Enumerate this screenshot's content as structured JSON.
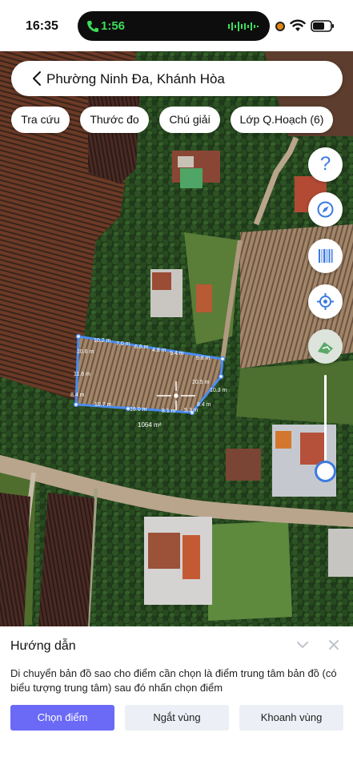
{
  "status_bar": {
    "time": "16:35",
    "call_timer": "1:56",
    "icons": [
      "phone-icon",
      "waveform-icon",
      "recording-dot-icon",
      "wifi-icon",
      "battery-icon"
    ]
  },
  "search": {
    "location": "Phường Ninh Đa, Khánh Hòa",
    "back_icon": "chevron-left-icon"
  },
  "chips": [
    "Tra cứu",
    "Thước đo",
    "Chú giải",
    "Lớp Q.Hoạch (6)"
  ],
  "side_controls": [
    "help-icon",
    "compass-icon",
    "barcode-icon",
    "locate-icon",
    "layers-icon"
  ],
  "map": {
    "parcel_area": "1064 m²",
    "measurements": [
      "10.2 m",
      "7.0 m",
      "6.6 m",
      "4.8 m",
      "9.4 m",
      "9.8 m",
      "20.5 m",
      "10.3 m",
      "8.4 m",
      "5.3 m",
      "8.1 m",
      "16.0 m",
      "10.7 m",
      "8.4 m",
      "11.6 m",
      "10.6 m"
    ],
    "accent_color": "#3d7be0"
  },
  "sheet": {
    "title": "Hướng dẫn",
    "description": "Di chuyển bản đồ sao cho điểm cần chọn là điểm trung tâm bản đồ (có biểu tượng trung tâm) sau đó nhấn chọn điểm",
    "buttons": {
      "choose_point": "Chọn điểm",
      "split_zone": "Ngắt vùng",
      "enclose_zone": "Khoanh vùng"
    },
    "primary_color": "#6a6af7"
  }
}
